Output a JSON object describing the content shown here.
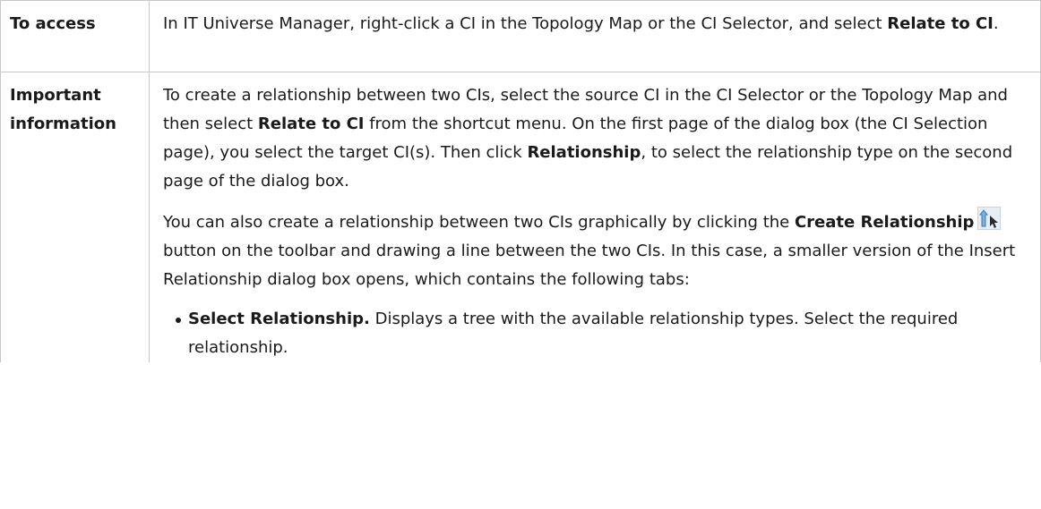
{
  "rows": [
    {
      "label": "To access",
      "content": {
        "t1": "In IT Universe Manager, right-click a CI in the Topology Map or the CI Selector, and select ",
        "b1": "Relate to CI",
        "t2": "."
      }
    },
    {
      "label": "Important information",
      "p1": {
        "t1": "To create a relationship between two CIs, select the source CI in the CI Selector or the Topology Map and then select ",
        "b1": "Relate to CI",
        "t2": " from the shortcut menu. On the first page of the dialog box (the CI Selection page), you select the target CI(s). Then click ",
        "b2": "Relationship",
        "t3": ", to select the relationship type on the second page of the dialog box."
      },
      "p2": {
        "t1": "You can also create a relationship between two CIs graphically by clicking the ",
        "b1": "Create Relationship",
        "t2": " button on the toolbar and drawing a line between the two CIs. In this case, a smaller version of the Insert Relationship dialog box opens, which contains the following tabs:"
      },
      "bullets": [
        {
          "b": "Select Relationship.",
          "t": " Displays a tree with the available relationship types. Select the required relationship."
        }
      ]
    }
  ],
  "icons": {
    "create_relationship": "create-relationship-icon"
  }
}
